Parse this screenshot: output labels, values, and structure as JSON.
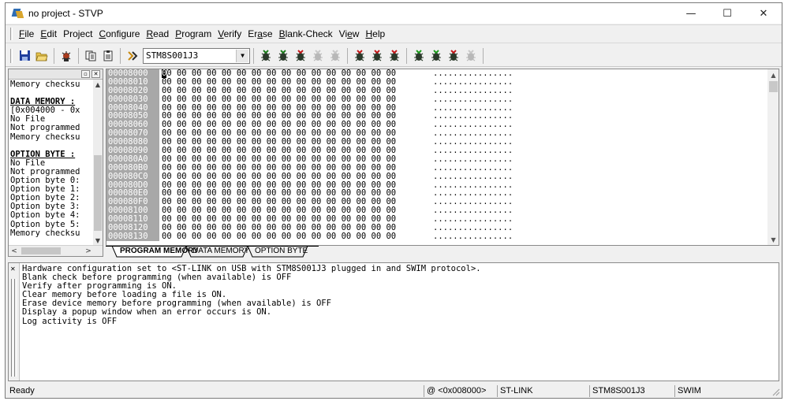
{
  "window": {
    "title": "no project - STVP"
  },
  "window_controls": {
    "minimize": "—",
    "maximize": "☐",
    "close": "✕"
  },
  "menu": [
    {
      "pre": "",
      "key": "F",
      "post": "ile"
    },
    {
      "pre": "",
      "key": "E",
      "post": "dit"
    },
    {
      "pre": "Pro",
      "key": "j",
      "post": "ect"
    },
    {
      "pre": "",
      "key": "C",
      "post": "onfigure"
    },
    {
      "pre": "",
      "key": "R",
      "post": "ead"
    },
    {
      "pre": "",
      "key": "P",
      "post": "rogram"
    },
    {
      "pre": "",
      "key": "V",
      "post": "erify"
    },
    {
      "pre": "Er",
      "key": "a",
      "post": "se"
    },
    {
      "pre": "",
      "key": "B",
      "post": "lank-Check"
    },
    {
      "pre": "Vi",
      "key": "e",
      "post": "w"
    },
    {
      "pre": "",
      "key": "H",
      "post": "elp"
    }
  ],
  "toolbar": {
    "device": "STM8S001J3",
    "icons": [
      "save-icon",
      "open-icon",
      "chip-icon",
      "copy-icon",
      "paste-icon",
      "device-icon"
    ],
    "action_icons": [
      "read-all-icon",
      "read-current-icon",
      "read-option-icon",
      "read-data-disabled-icon",
      "read-mem-disabled-icon",
      "program-all-icon",
      "program-current-icon",
      "program-option-icon",
      "verify-all-icon",
      "verify-current-icon",
      "verify-option-icon",
      "verify-data-disabled-icon"
    ]
  },
  "left_panel": {
    "lines": [
      {
        "text": "Memory checksu",
        "hdr": false
      },
      {
        "text": "",
        "hdr": false
      },
      {
        "text": "DATA MEMORY :",
        "hdr": true
      },
      {
        "text": "[0x004000 - 0x",
        "hdr": false
      },
      {
        "text": "No File",
        "hdr": false
      },
      {
        "text": "Not programmed",
        "hdr": false
      },
      {
        "text": "Memory checksu",
        "hdr": false
      },
      {
        "text": "",
        "hdr": false
      },
      {
        "text": "OPTION BYTE :",
        "hdr": true
      },
      {
        "text": "No File",
        "hdr": false
      },
      {
        "text": "Not programmed",
        "hdr": false
      },
      {
        "text": "Option byte 0:",
        "hdr": false
      },
      {
        "text": "Option byte 1:",
        "hdr": false
      },
      {
        "text": "Option byte 2:",
        "hdr": false
      },
      {
        "text": "Option byte 3:",
        "hdr": false
      },
      {
        "text": "Option byte 4:",
        "hdr": false
      },
      {
        "text": "Option byte 5:",
        "hdr": false
      },
      {
        "text": "Memory checksu",
        "hdr": false
      }
    ]
  },
  "hex": {
    "addresses": [
      "00008000",
      "00008010",
      "00008020",
      "00008030",
      "00008040",
      "00008050",
      "00008060",
      "00008070",
      "00008080",
      "00008090",
      "000080A0",
      "000080B0",
      "000080C0",
      "000080D0",
      "000080E0",
      "000080F0",
      "00008100",
      "00008110",
      "00008120",
      "00008130"
    ],
    "bytes": "00 00 00 00 00 00 00 00 00 00 00 00 00 00 00 00",
    "ascii": "................"
  },
  "tabs": [
    "PROGRAM MEMORY",
    "DATA MEMORY",
    "OPTION BYTE"
  ],
  "log": [
    "Hardware configuration set to <ST-LINK on USB with STM8S001J3 plugged in and SWIM protocol>.",
    "Blank check before programming (when available) is OFF",
    "Verify after programming is ON.",
    "Clear memory before loading a file is ON.",
    "Erase device memory before programming (when available) is OFF",
    "Display a popup window when an error occurs is ON.",
    "Log activity is OFF"
  ],
  "status": {
    "ready": "Ready",
    "address": "@ <0x008000>",
    "tool": "ST-LINK",
    "device": "STM8S001J3",
    "protocol": "SWIM"
  }
}
